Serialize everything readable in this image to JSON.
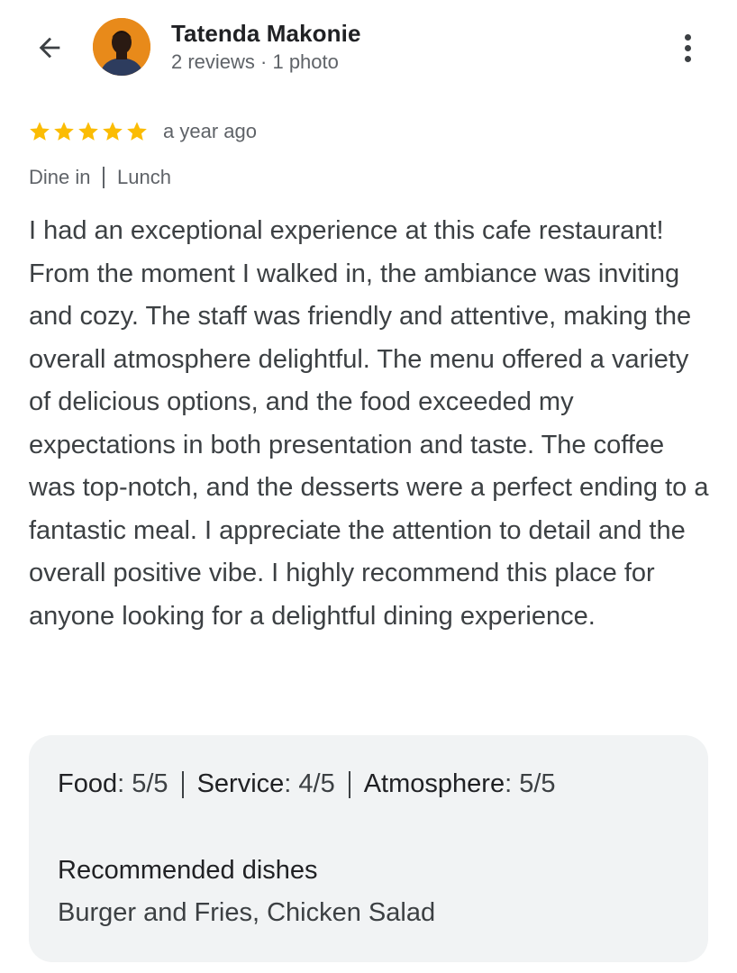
{
  "user": {
    "name": "Tatenda Makonie",
    "meta": "2 reviews · 1 photo"
  },
  "review": {
    "rating": 5,
    "max_rating": 5,
    "time_ago": "a year ago",
    "tags": [
      "Dine in",
      "Lunch"
    ],
    "text": "I had an exceptional experience at this cafe restaurant! From the moment I walked in, the ambiance was inviting and cozy. The staff was friendly and attentive, making the overall atmosphere delightful. The menu offered a variety of delicious options, and the food exceeded my expectations in both presentation and taste. The coffee was top-notch, and the desserts were a perfect ending to a fantastic meal. I appreciate the attention to detail and the overall positive vibe. I highly recommend this place for anyone looking for a delightful dining experience."
  },
  "details": {
    "ratings": [
      {
        "label": "Food",
        "value": "5/5"
      },
      {
        "label": "Service",
        "value": "4/5"
      },
      {
        "label": "Atmosphere",
        "value": "5/5"
      }
    ],
    "recommended_title": "Recommended dishes",
    "recommended_dishes": "Burger and Fries, Chicken Salad"
  },
  "icons": {
    "back": "arrow-back-icon",
    "more": "more-vertical-icon",
    "star": "star-icon"
  },
  "colors": {
    "star": "#fbbc04",
    "card_bg": "#f1f3f4",
    "secondary_text": "#5f6368",
    "avatar_bg": "#e88a1a"
  }
}
